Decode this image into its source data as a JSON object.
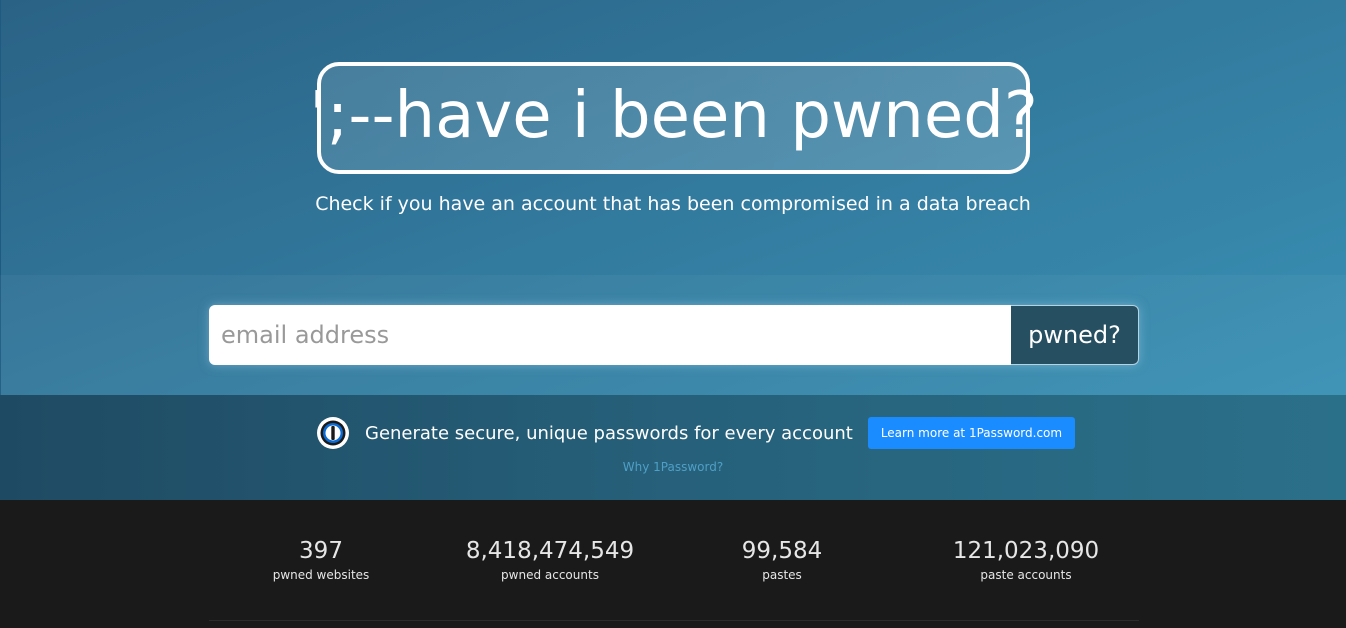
{
  "hero": {
    "logo_text": "';--have i been pwned?",
    "tagline": "Check if you have an account that has been compromised in a data breach"
  },
  "search": {
    "placeholder": "email address",
    "button_label": "pwned?"
  },
  "promo": {
    "icon": "1password-icon",
    "text": "Generate secure, unique passwords for every account",
    "button_label": "Learn more at 1Password.com",
    "link_label": "Why 1Password?"
  },
  "stats": [
    {
      "value": "397",
      "label": "pwned websites"
    },
    {
      "value": "8,418,474,549",
      "label": "pwned accounts"
    },
    {
      "value": "99,584",
      "label": "pastes"
    },
    {
      "value": "121,023,090",
      "label": "paste accounts"
    }
  ],
  "colors": {
    "hero_start": "#2a6285",
    "hero_end": "#3b96b9",
    "search_button": "#264f62",
    "promo_button": "#1a8cff",
    "stats_bg": "#1a1a1a"
  }
}
